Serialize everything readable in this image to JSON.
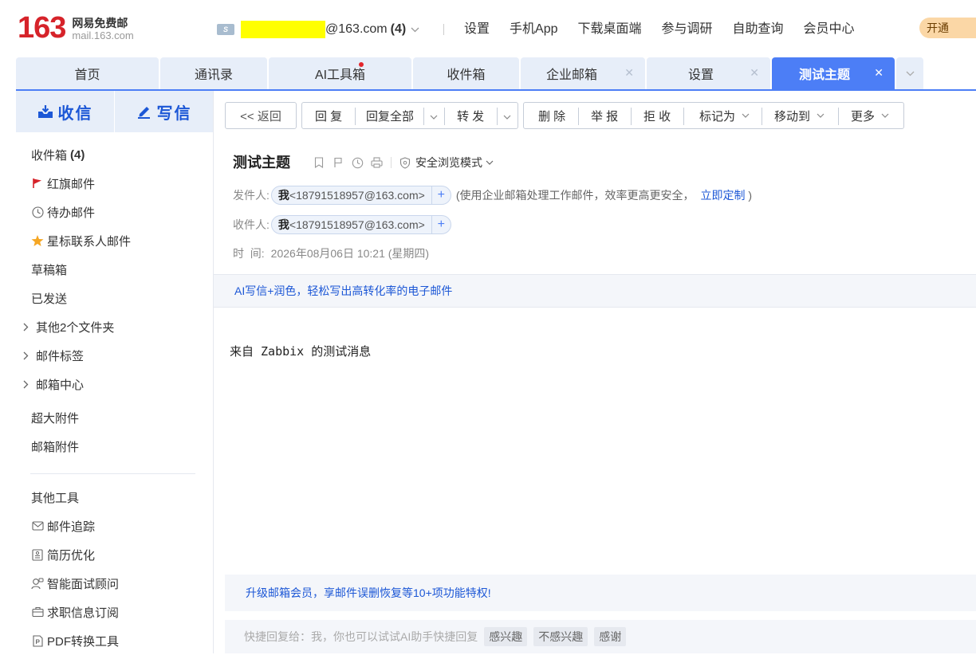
{
  "header": {
    "logo_number": "163",
    "logo_cn": "网易免费邮",
    "logo_en": "mail.163.com",
    "account_badge": "S",
    "account_domain": "@163.com",
    "account_count": "(4)",
    "links": [
      "设置",
      "手机App",
      "下载桌面端",
      "参与调研",
      "自助查询",
      "会员中心"
    ],
    "open_button": "开通"
  },
  "tabs": [
    {
      "label": "首页"
    },
    {
      "label": "通讯录"
    },
    {
      "label": "AI工具箱"
    },
    {
      "label": "收件箱"
    },
    {
      "label": "企业邮箱"
    },
    {
      "label": "设置"
    },
    {
      "label": "测试主题"
    }
  ],
  "sidebar": {
    "receive": "收信",
    "compose": "写信",
    "folders": [
      {
        "label": "收件箱",
        "count": "(4)"
      },
      {
        "label": "红旗邮件"
      },
      {
        "label": "待办邮件"
      },
      {
        "label": "星标联系人邮件"
      },
      {
        "label": "草稿箱"
      },
      {
        "label": "已发送"
      },
      {
        "label": "其他2个文件夹"
      },
      {
        "label": "邮件标签"
      },
      {
        "label": "邮箱中心"
      },
      {
        "label": "超大附件"
      },
      {
        "label": "邮箱附件"
      }
    ],
    "tools_title": "其他工具",
    "tools": [
      {
        "label": "邮件追踪"
      },
      {
        "label": "简历优化"
      },
      {
        "label": "智能面试顾问"
      },
      {
        "label": "求职信息订阅"
      },
      {
        "label": "PDF转换工具"
      }
    ]
  },
  "toolbar": {
    "back": "<< 返回",
    "reply": "回 复",
    "reply_all": "回复全部",
    "forward": "转 发",
    "delete": "删 除",
    "report": "举 报",
    "reject": "拒 收",
    "mark_as": "标记为",
    "move_to": "移动到",
    "more": "更多"
  },
  "mail": {
    "subject": "测试主题",
    "safe_mode": "安全浏览模式",
    "from_label": "发件人:",
    "from_name": "我",
    "from_addr": "<18791518957@163.com>",
    "from_note": "(使用企业邮箱处理工作邮件，效率更高更安全，",
    "from_note_link": "立即定制",
    "from_note_end": ")",
    "to_label": "收件人:",
    "to_name": "我",
    "to_addr": "<18791518957@163.com>",
    "time_label": "时  间:",
    "time_value": "2026年08月06日 10:21 (星期四)",
    "ai_banner": "AI写信+润色，轻松写出高转化率的电子邮件",
    "body": "来自 Zabbix 的测试消息",
    "upgrade_banner": "升级邮箱会员，享邮件误删恢复等10+项功能特权!",
    "quick_reply": "快捷回复给：我，你也可以试试AI助手快捷回复",
    "quick_tags": [
      "感兴趣",
      "不感兴趣",
      "感谢"
    ]
  },
  "colors": {
    "brand_red": "#d6232a",
    "accent_blue": "#4c7ef6",
    "link_blue": "#1c57d6"
  }
}
